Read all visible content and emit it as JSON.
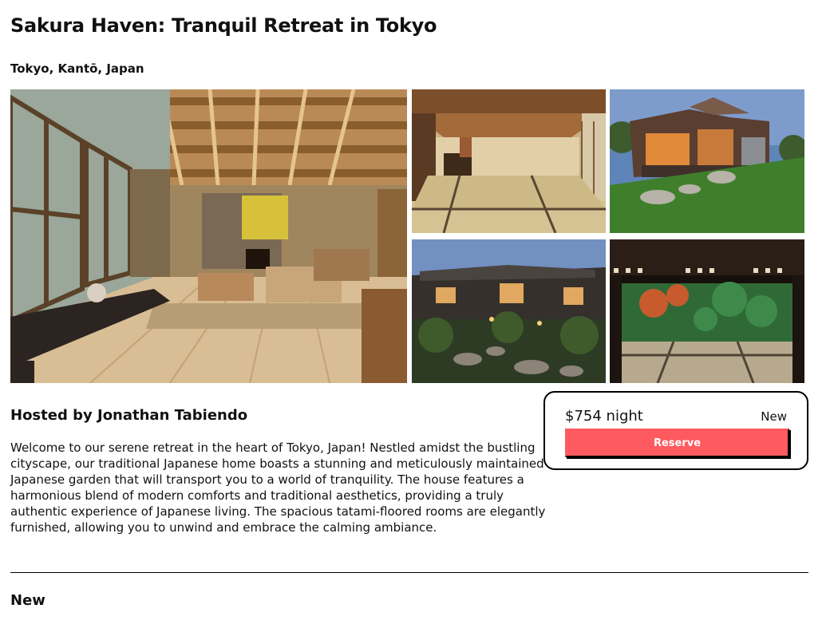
{
  "listing": {
    "title": "Sakura Haven: Tranquil Retreat in Tokyo",
    "location": "Tokyo, Kantō, Japan"
  },
  "gallery": {
    "photos": [
      "living-room-photo",
      "tatami-room-photo",
      "house-exterior-photo",
      "courtyard-garden-photo",
      "garden-view-photo"
    ]
  },
  "host": {
    "label": "Hosted by Jonathan Tabiendo",
    "description": "Welcome to our serene retreat in the heart of Tokyo, Japan! Nestled amidst the bustling cityscape, our traditional Japanese home boasts a stunning and meticulously maintained Japanese garden that will transport you to a world of tranquility. The house features a harmonious blend of modern comforts and traditional aesthetics, providing a truly authentic experience of Japanese living. The spacious tatami-floored rooms are elegantly furnished, allowing you to unwind and embrace the calming ambiance."
  },
  "booking": {
    "price": "$754 night",
    "badge": "New",
    "reserve_label": "Reserve"
  },
  "reviews": {
    "label": "New"
  },
  "colors": {
    "accent": "#ff5a5f"
  }
}
